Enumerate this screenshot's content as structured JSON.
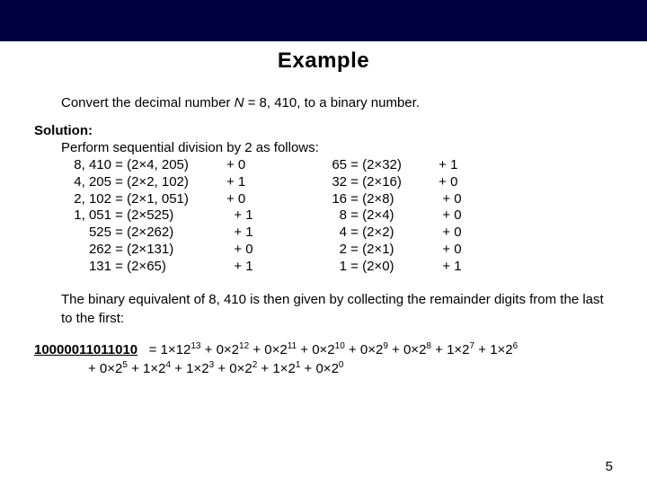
{
  "title": "Example",
  "prompt_pre": "Convert the decimal number ",
  "prompt_var": "N",
  "prompt_post": " = 8, 410, to a binary number.",
  "solution_label": "Solution:",
  "solution_lead": "Perform sequential division by 2 as follows:",
  "left_rows": [
    {
      "lhs": "8, 410",
      "eq": " = (2×4, 205)",
      "rem": "+ 0"
    },
    {
      "lhs": "4, 205",
      "eq": " = (2×2, 102)",
      "rem": "+ 1"
    },
    {
      "lhs": "2, 102",
      "eq": " = (2×1, 051)",
      "rem": "+ 0"
    },
    {
      "lhs": "1, 051",
      "eq": " = (2×525)",
      "rem": "  + 1"
    },
    {
      "lhs": "525",
      "eq": " = (2×262)",
      "rem": "  + 1"
    },
    {
      "lhs": "262",
      "eq": " = (2×131)",
      "rem": "  + 0"
    },
    {
      "lhs": "131",
      "eq": " = (2×65)",
      "rem": "  + 1"
    }
  ],
  "right_rows": [
    {
      "lhs": "65",
      "eq": " = (2×32)",
      "rem": " + 1"
    },
    {
      "lhs": "32",
      "eq": " = (2×16)",
      "rem": " + 0"
    },
    {
      "lhs": "16",
      "eq": " = (2×8)",
      "rem": "  + 0"
    },
    {
      "lhs": "8",
      "eq": " = (2×4)",
      "rem": "  + 0"
    },
    {
      "lhs": "4",
      "eq": " = (2×2)",
      "rem": "  + 0"
    },
    {
      "lhs": "2",
      "eq": " = (2×1)",
      "rem": "  + 0"
    },
    {
      "lhs": "1",
      "eq": " = (2×0)",
      "rem": "  + 1"
    }
  ],
  "explain": "The binary equivalent of 8, 410 is then given by collecting the remainder digits from the last to the first:",
  "binary": "10000011011010",
  "terms": [
    {
      "c": "1",
      "b": "12",
      "e": "13"
    },
    {
      "c": "0",
      "b": "2",
      "e": "12"
    },
    {
      "c": "0",
      "b": "2",
      "e": "11"
    },
    {
      "c": "0",
      "b": "2",
      "e": "10"
    },
    {
      "c": "0",
      "b": "2",
      "e": "9"
    },
    {
      "c": "0",
      "b": "2",
      "e": "8"
    },
    {
      "c": "1",
      "b": "2",
      "e": "7"
    },
    {
      "c": "1",
      "b": "2",
      "e": "6"
    },
    {
      "c": "0",
      "b": "2",
      "e": "5"
    },
    {
      "c": "1",
      "b": "2",
      "e": "4"
    },
    {
      "c": "1",
      "b": "2",
      "e": "3"
    },
    {
      "c": "0",
      "b": "2",
      "e": "2"
    },
    {
      "c": "1",
      "b": "2",
      "e": "1"
    },
    {
      "c": "0",
      "b": "2",
      "e": "0"
    }
  ],
  "break_after_index": 7,
  "page": "5"
}
